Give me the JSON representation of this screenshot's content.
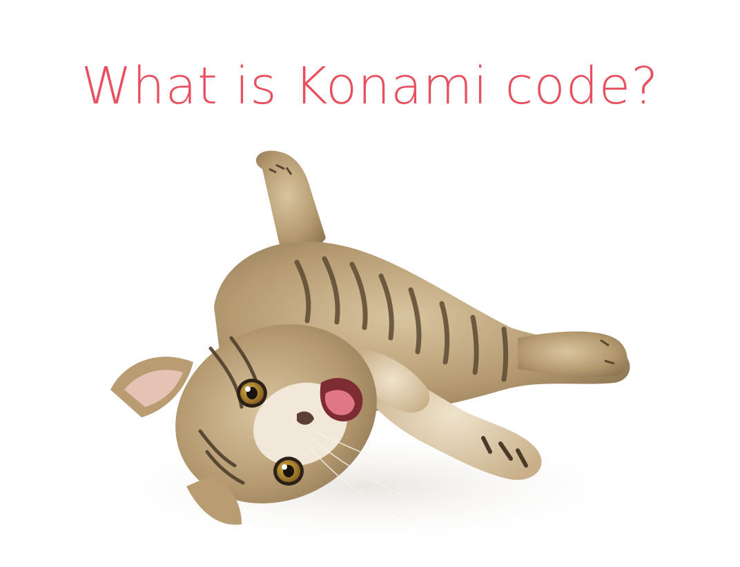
{
  "slide": {
    "title": "What is Konami code?",
    "title_color": "#e8505f",
    "image_subject": "tabby-kitten-lying-on-side"
  }
}
